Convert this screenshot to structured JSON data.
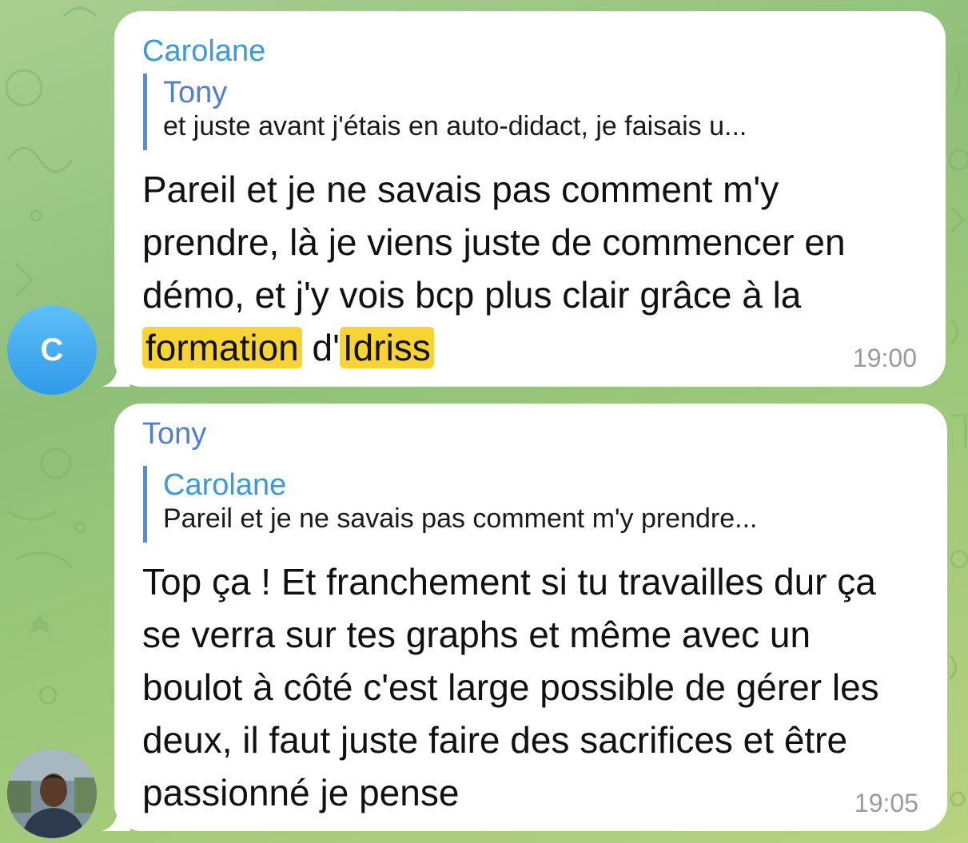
{
  "messages": [
    {
      "sender": "Carolane",
      "avatar_letter": "C",
      "reply_to": {
        "name": "Tony",
        "text": "et juste avant j'étais en auto-didact, je faisais u..."
      },
      "text_parts": [
        "Pareil et je ne savais pas comment m'y prendre, là je viens juste de commencer en démo, et j'y vois bcp plus clair grâce à la ",
        "formation",
        " d'",
        "Idriss"
      ],
      "time": "19:00"
    },
    {
      "sender": "Tony",
      "reply_to": {
        "name": "Carolane",
        "text": "Pareil et je ne savais pas comment m'y prendre..."
      },
      "text": "Top ça ! Et franchement si tu travailles dur ça se verra sur tes graphs et même avec un boulot à côté c'est large possible de gérer les deux, il faut juste faire des sacrifices et être passionné je pense",
      "time": "19:05"
    }
  ],
  "colors": {
    "highlight": "#f7d433",
    "sender_carolane": "#3a9bd6",
    "sender_tony": "#4f7fd0",
    "reply_bar": "#4d8fd8",
    "avatar_c": "#3aa6ee"
  }
}
